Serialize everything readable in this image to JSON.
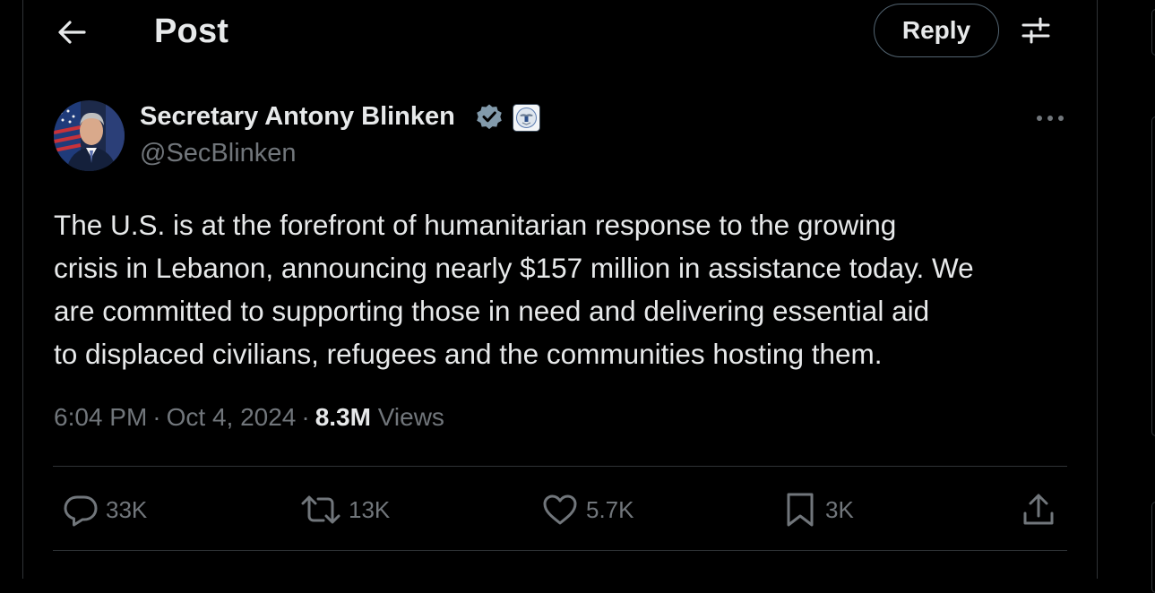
{
  "header": {
    "title": "Post",
    "reply_label": "Reply"
  },
  "author": {
    "name": "Secretary Antony Blinken",
    "handle": "@SecBlinken"
  },
  "post": {
    "lines": [
      "The U.S. is at the forefront of humanitarian response to the growing",
      "crisis in Lebanon, announcing nearly $157 million in assistance today. We",
      "are committed to supporting those in need and delivering essential aid",
      "to displaced civilians, refugees and the communities hosting them."
    ],
    "time": "6:04 PM",
    "date": "Oct 4, 2024",
    "views_count": "8.3M",
    "views_label": "Views"
  },
  "actions": {
    "replies": "33K",
    "reposts": "13K",
    "likes": "5.7K",
    "bookmarks": "3K"
  },
  "icons": {
    "back": "arrow-left-icon",
    "settings": "sliders-icon",
    "verified": "verified-badge-icon",
    "affiliation": "state-department-seal-icon",
    "more": "more-horizontal-icon",
    "reply": "comment-bubble-icon",
    "repost": "repost-icon",
    "like": "heart-icon",
    "bookmark": "bookmark-icon",
    "share": "share-upload-icon"
  },
  "colors": {
    "background": "#000000",
    "text_primary": "#e7e9ea",
    "text_secondary": "#71767b",
    "divider": "#2f3336",
    "verified": "#829aab"
  }
}
